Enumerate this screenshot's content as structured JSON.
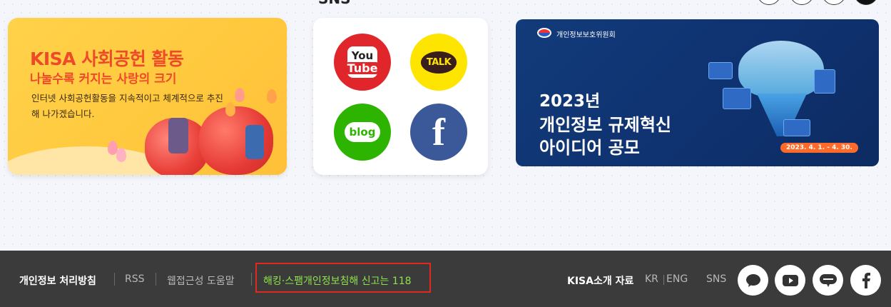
{
  "sections": {
    "sns_title": "SNS"
  },
  "contrib_banner": {
    "title": "KISA 사회공헌 활동",
    "subtitle": "나눌수록 커지는 사랑의 크기",
    "description": "인터넷 사회공헌활동을 지속적이고 체계적으로 추진해 나가겠습니다."
  },
  "sns_card": {
    "youtube_you": "You",
    "youtube_tube": "Tube",
    "kakao_label": "TALK",
    "blog_label": "blog",
    "facebook_label": "f"
  },
  "contest_banner": {
    "org_name": "개인정보보호위원회",
    "year": "2023년",
    "title_line1": "개인정보 규제혁신",
    "title_line2": "아이디어 공모",
    "period": "2023. 4. 1. - 4. 30."
  },
  "footer": {
    "privacy_policy": "개인정보 처리방침",
    "rss": "RSS",
    "accessibility": "웹접근성 도움말",
    "report": "해킹·스팸개인정보침해 신고는 118",
    "kisa_intro": "KISA소개 자료",
    "lang_kr": "KR",
    "lang_en": "ENG",
    "sns_label": "SNS"
  },
  "colors": {
    "footer_bg": "#3b3b3b",
    "report_text": "#8ee34a",
    "report_border": "#e4281f",
    "contrib_accent": "#ee4a2a",
    "contest_bg": "#123b7a"
  },
  "icons": [
    "youtube-icon",
    "kakaotalk-icon",
    "blog-icon",
    "facebook-icon",
    "chat-bubble-icon"
  ]
}
